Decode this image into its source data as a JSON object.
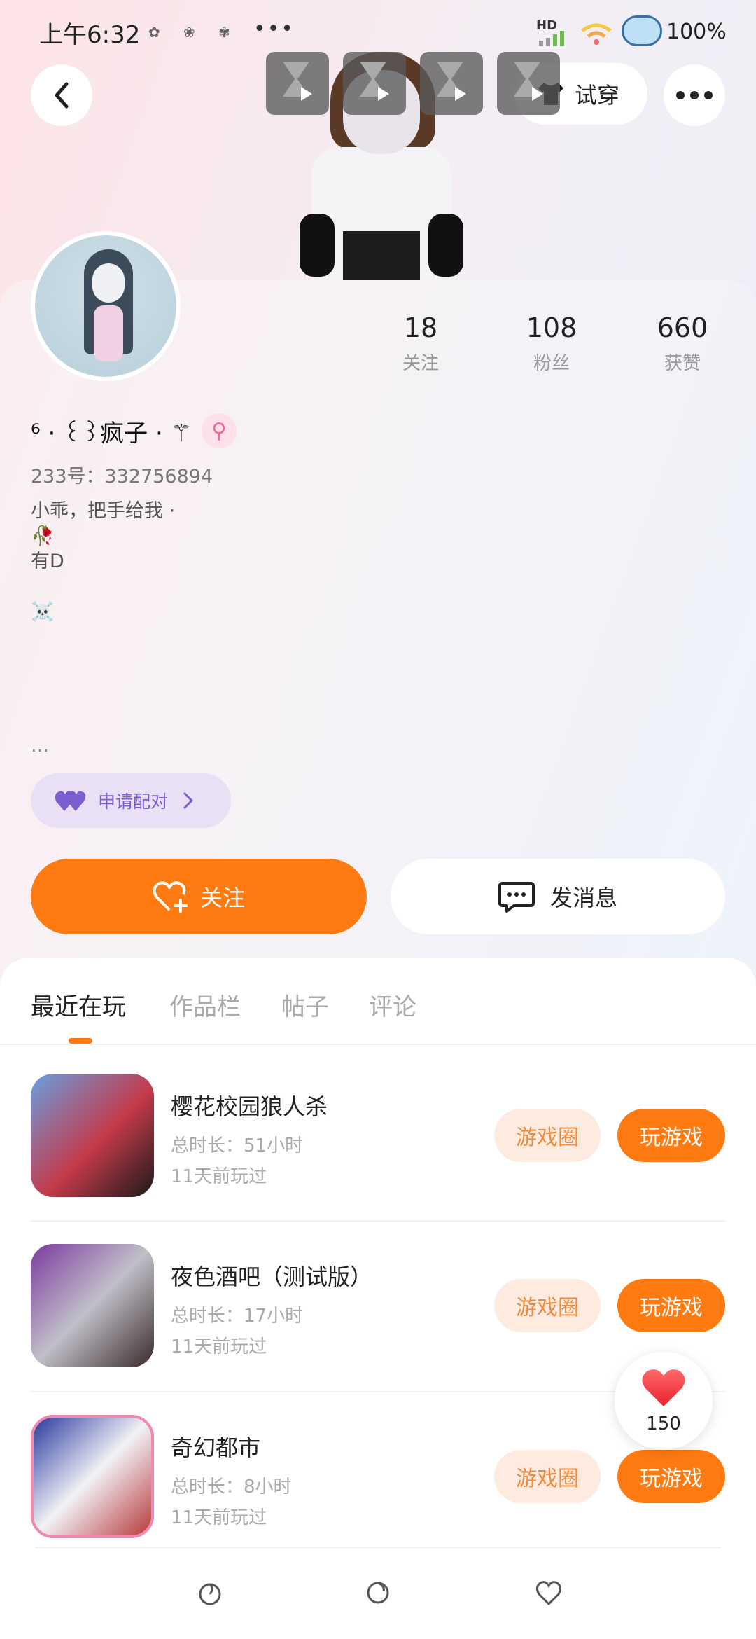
{
  "status_bar": {
    "time": "上午6:32",
    "more_dots": "•••",
    "hd": "HD",
    "battery": "100%"
  },
  "header": {
    "back_icon": "chevron-left-icon",
    "try_on_label": "试穿",
    "more_icon": "more-horizontal-icon"
  },
  "profile": {
    "stats": [
      {
        "value": "18",
        "label": "关注"
      },
      {
        "value": "108",
        "label": "粉丝"
      },
      {
        "value": "660",
        "label": "获赞"
      }
    ],
    "nickname": "⁶ · ꒰꒱疯子 · ⚚",
    "gender_symbol": "⚲",
    "id_line": "233号：332756894",
    "bio_lines": [
      "小乖，把手给我 ·",
      "🥀",
      "有D",
      "",
      "☠️"
    ],
    "bio_more": "…",
    "pair_label": "申请配对",
    "follow_label": "关注",
    "message_label": "发消息"
  },
  "tabs": [
    {
      "label": "最近在玩",
      "active": true
    },
    {
      "label": "作品栏",
      "active": false
    },
    {
      "label": "帖子",
      "active": false
    },
    {
      "label": "评论",
      "active": false
    }
  ],
  "games": [
    {
      "title": "樱花校园狼人杀",
      "duration": "总时长：51小时",
      "last_played": "11天前玩过",
      "circle_label": "游戏圈",
      "play_label": "玩游戏"
    },
    {
      "title": "夜色酒吧（测试版）",
      "duration": "总时长：17小时",
      "last_played": "11天前玩过",
      "circle_label": "游戏圈",
      "play_label": "玩游戏"
    },
    {
      "title": "奇幻都市",
      "duration": "总时长：8小时",
      "last_played": "11天前玩过",
      "circle_label": "游戏圈",
      "play_label": "玩游戏"
    }
  ],
  "like_float": {
    "count": "150"
  },
  "colors": {
    "accent": "#ff7a11",
    "chip_bg": "#fdebe0",
    "pair_bg": "#e9e0f6"
  }
}
